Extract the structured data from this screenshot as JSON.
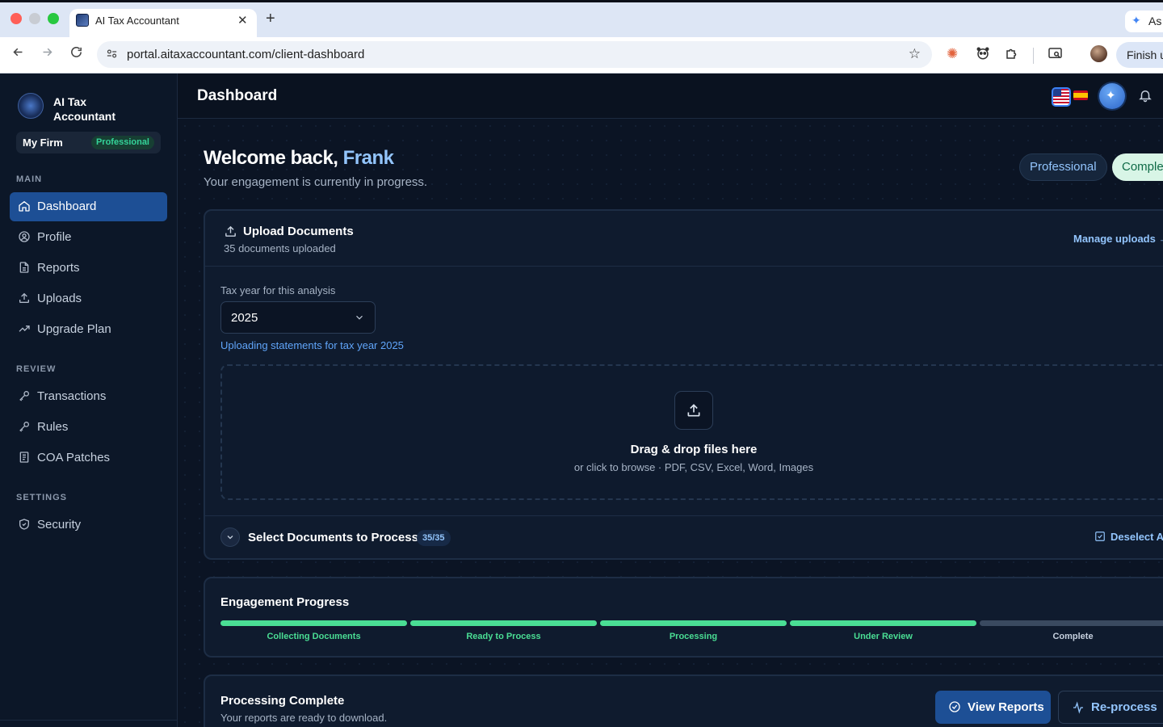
{
  "browser": {
    "tab_title": "AI Tax Accountant",
    "tab_close": "✕",
    "new_tab": "+",
    "url": "portal.aitaxaccountant.com/client-dashboard",
    "extension_label": "As",
    "finish_label": "Finish u"
  },
  "sidebar": {
    "brand": "AI Tax Accountant",
    "firm_name": "My Firm",
    "firm_plan": "Professional",
    "sections": [
      {
        "title": "MAIN",
        "items": [
          {
            "label": "Dashboard",
            "icon": "home-icon",
            "active": true
          },
          {
            "label": "Profile",
            "icon": "user-circle-icon"
          },
          {
            "label": "Reports",
            "icon": "file-icon"
          },
          {
            "label": "Uploads",
            "icon": "upload-icon"
          },
          {
            "label": "Upgrade Plan",
            "icon": "trending-up-icon"
          }
        ]
      },
      {
        "title": "REVIEW",
        "items": [
          {
            "label": "Transactions",
            "icon": "key-icon"
          },
          {
            "label": "Rules",
            "icon": "key-icon"
          },
          {
            "label": "COA Patches",
            "icon": "list-file-icon"
          }
        ]
      },
      {
        "title": "SETTINGS",
        "items": [
          {
            "label": "Security",
            "icon": "shield-icon"
          }
        ]
      }
    ]
  },
  "header": {
    "title": "Dashboard"
  },
  "welcome": {
    "greeting": "Welcome back,",
    "name": "Frank",
    "subtitle": "Your engagement is currently in progress.",
    "plan_badge": "Professional",
    "status_badge": "Complete"
  },
  "upload": {
    "title": "Upload Documents",
    "subtitle": "35 documents uploaded",
    "manage_link": "Manage uploads →",
    "tax_year_label": "Tax year for this analysis",
    "tax_year_value": "2025",
    "tax_year_note": "Uploading statements for tax year 2025",
    "dropzone_title": "Drag & drop files here",
    "dropzone_sub": "or click to browse · PDF, CSV, Excel, Word, Images",
    "select_title": "Select Documents to Process",
    "select_count": "35/35",
    "deselect_label": "Deselect All"
  },
  "progress": {
    "title": "Engagement Progress",
    "steps": [
      {
        "label": "Collecting Documents",
        "done": true
      },
      {
        "label": "Ready to Process",
        "done": true
      },
      {
        "label": "Processing",
        "done": true
      },
      {
        "label": "Under Review",
        "done": true
      },
      {
        "label": "Complete",
        "done": false
      }
    ],
    "colors": {
      "done_bar": "#4ade94",
      "done_text": "#4ade94",
      "todo_bar": "#3a4a60",
      "todo_text": "#c6d0de"
    }
  },
  "complete": {
    "title": "Processing Complete",
    "subtitle": "Your reports are ready to download.",
    "view_reports": "View Reports",
    "reprocess": "Re-process"
  }
}
